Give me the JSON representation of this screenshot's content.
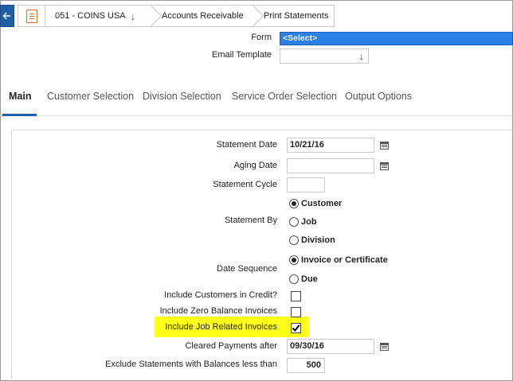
{
  "breadcrumb": {
    "company": "051 - COINS USA",
    "module": "Accounts Receivable",
    "page": "Print Statements"
  },
  "header": {
    "form_label": "Form",
    "form_value": "<Select>",
    "email_template_label": "Email Template",
    "email_template_value": ""
  },
  "tabs": [
    {
      "label": "Main",
      "active": true
    },
    {
      "label": "Customer Selection",
      "active": false
    },
    {
      "label": "Division Selection",
      "active": false
    },
    {
      "label": "Service Order Selection",
      "active": false
    },
    {
      "label": "Output Options",
      "active": false
    }
  ],
  "main": {
    "statement_date_label": "Statement Date",
    "statement_date_value": "10/21/16",
    "aging_date_label": "Aging Date",
    "aging_date_value": "",
    "statement_cycle_label": "Statement Cycle",
    "statement_cycle_value": "",
    "statement_by_label": "Statement By",
    "statement_by_options": [
      {
        "label": "Customer",
        "selected": true
      },
      {
        "label": "Job",
        "selected": false
      },
      {
        "label": "Division",
        "selected": false
      }
    ],
    "date_sequence_label": "Date Sequence",
    "date_sequence_options": [
      {
        "label": "Invoice or Certificate",
        "selected": true
      },
      {
        "label": "Due",
        "selected": false
      }
    ],
    "include_credit_label": "Include Customers in Credit?",
    "include_credit_checked": false,
    "include_zero_label": "Include Zero Balance Invoices",
    "include_zero_checked": false,
    "include_job_label": "Include Job Related Invoices",
    "include_job_checked": true,
    "cleared_payments_label": "Cleared Payments after",
    "cleared_payments_value": "09/30/16",
    "exclude_balance_label": "Exclude Statements with Balances less than",
    "exclude_balance_value": "500"
  },
  "colors": {
    "accent": "#1e5fa8",
    "select_highlight": "#2b80e5",
    "annotation_highlight": "#ffff1a"
  }
}
